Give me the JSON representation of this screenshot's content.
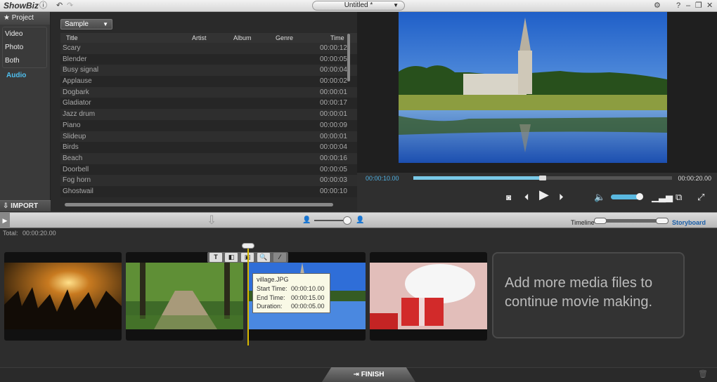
{
  "app": {
    "name": "ShowBiz",
    "project_title": "Untitled *"
  },
  "window_controls": [
    "gear-icon",
    "help-icon",
    "minimize-icon",
    "restore-icon",
    "close-icon"
  ],
  "sidebar": {
    "header": "Project",
    "items": [
      {
        "label": "Video"
      },
      {
        "label": "Photo"
      },
      {
        "label": "Both"
      },
      {
        "label": "Audio",
        "active": true
      }
    ],
    "import_label": "IMPORT"
  },
  "library": {
    "category": "Sample",
    "columns": [
      "Title",
      "Artist",
      "Album",
      "Genre",
      "Time"
    ],
    "rows": [
      {
        "title": "Scary",
        "time": "00:00:12"
      },
      {
        "title": "Blender",
        "time": "00:00:05"
      },
      {
        "title": "Busy signal",
        "time": "00:00:04"
      },
      {
        "title": "Applause",
        "time": "00:00:02"
      },
      {
        "title": "Dogbark",
        "time": "00:00:01"
      },
      {
        "title": "Gladiator",
        "time": "00:00:17"
      },
      {
        "title": "Jazz drum",
        "time": "00:00:01"
      },
      {
        "title": "Piano",
        "time": "00:00:09"
      },
      {
        "title": "Slideup",
        "time": "00:00:01"
      },
      {
        "title": "Birds",
        "time": "00:00:04"
      },
      {
        "title": "Beach",
        "time": "00:00:16"
      },
      {
        "title": "Doorbell",
        "time": "00:00:05"
      },
      {
        "title": "Fog horn",
        "time": "00:00:03"
      },
      {
        "title": "Ghostwail",
        "time": "00:00:10"
      }
    ]
  },
  "player": {
    "current_time": "00:00:10.00",
    "total_time": "00:00:20.00",
    "progress": 0.5,
    "volume": 0.9
  },
  "midbar": {
    "timeline_label": "Timeline",
    "storyboard_label": "Storyboard"
  },
  "storyboard": {
    "total_label": "Total:",
    "total_time": "00:00:20.00",
    "placeholder_line1": "Add more media files to",
    "placeholder_line2": "continue movie making.",
    "tooltip": {
      "file": "village.JPG",
      "start_label": "Start Time:",
      "start": "00:00:10.00",
      "end_label": "End Time:",
      "end": "00:00:15.00",
      "duration_label": "Duration:",
      "duration": "00:00:05.00"
    },
    "clip_tools": [
      "T",
      "transition",
      "effect",
      "zoom",
      "more"
    ],
    "finish_label": "FINISH"
  },
  "colors": {
    "accent": "#4fb0e0",
    "playhead": "#d8b800"
  }
}
